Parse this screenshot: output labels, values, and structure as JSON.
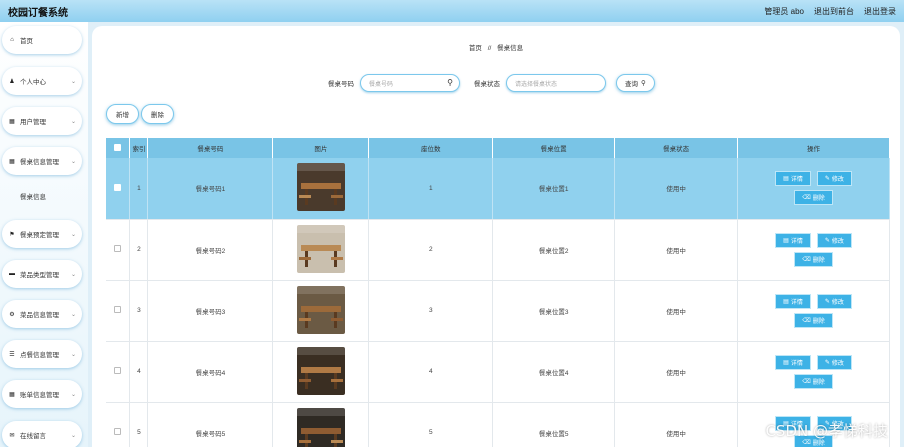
{
  "app": {
    "title": "校园订餐系统"
  },
  "topbar": {
    "user": "管理员 abo",
    "back_front": "退出到前台",
    "logout": "退出登录"
  },
  "sidebar": {
    "items": [
      {
        "icon": "home-icon",
        "label": "首页",
        "has_chevron": false
      },
      {
        "icon": "user-icon",
        "label": "个人中心",
        "has_chevron": true
      },
      {
        "icon": "grid-icon",
        "label": "用户管理",
        "has_chevron": true
      },
      {
        "icon": "grid-icon",
        "label": "餐桌信息管理",
        "has_chevron": true
      },
      {
        "icon": "flag-icon",
        "label": "餐桌预定管理",
        "has_chevron": true
      },
      {
        "icon": "card-icon",
        "label": "菜品类型管理",
        "has_chevron": true
      },
      {
        "icon": "settings-icon",
        "label": "菜品信息管理",
        "has_chevron": true
      },
      {
        "icon": "list-icon",
        "label": "点餐信息管理",
        "has_chevron": true
      },
      {
        "icon": "grid-icon",
        "label": "账单信息管理",
        "has_chevron": true
      },
      {
        "icon": "chat-icon",
        "label": "在线留言",
        "has_chevron": true
      }
    ],
    "sub_item": "餐桌信息"
  },
  "breadcrumb": {
    "home": "首页",
    "sep": "//",
    "current": "餐桌信息"
  },
  "search": {
    "code_label": "餐桌号码",
    "code_placeholder": "餐桌号码",
    "status_label": "餐桌状态",
    "status_placeholder": "请选择餐桌状态",
    "query_label": "查询"
  },
  "actions": {
    "add": "新增",
    "delete": "删除"
  },
  "table": {
    "columns": [
      "索引",
      "餐桌号码",
      "图片",
      "座位数",
      "餐桌位置",
      "餐桌状态",
      "操作"
    ],
    "rows": [
      {
        "index": "1",
        "code": "餐桌号码1",
        "seats": "1",
        "location": "餐桌位置1",
        "status": "使用中"
      },
      {
        "index": "2",
        "code": "餐桌号码2",
        "seats": "2",
        "location": "餐桌位置2",
        "status": "使用中"
      },
      {
        "index": "3",
        "code": "餐桌号码3",
        "seats": "3",
        "location": "餐桌位置3",
        "status": "使用中"
      },
      {
        "index": "4",
        "code": "餐桌号码4",
        "seats": "4",
        "location": "餐桌位置4",
        "status": "使用中"
      },
      {
        "index": "5",
        "code": "餐桌号码5",
        "seats": "5",
        "location": "餐桌位置5",
        "status": "使用中"
      }
    ],
    "op_labels": {
      "detail": "详情",
      "edit": "修改",
      "delete": "删除"
    }
  },
  "watermark": "CSDN @孝悌科技",
  "colors": {
    "header": "#79c4e6",
    "highlight_row": "#90d1ee",
    "op_button": "#3db2e6",
    "topbar": "#8fd0f0"
  }
}
